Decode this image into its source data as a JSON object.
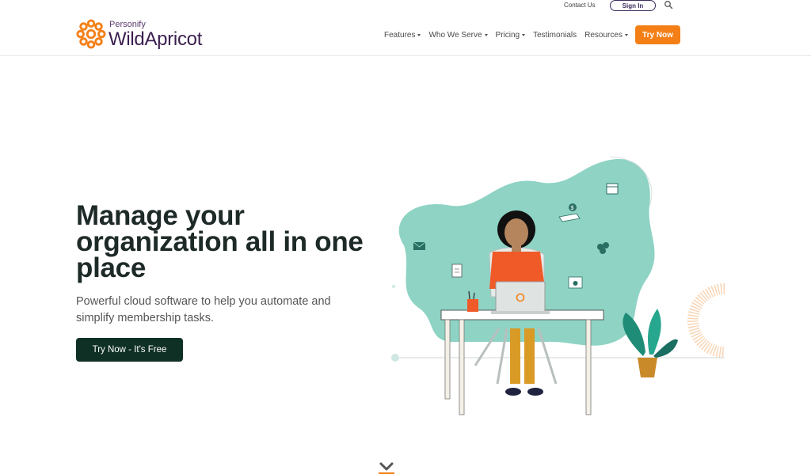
{
  "util": {
    "contact_label": "Contact Us",
    "signin_label": "Sign In",
    "search_icon": "search-icon"
  },
  "logo": {
    "personify": "Personify",
    "name": "WildApricot"
  },
  "nav": {
    "items": [
      {
        "label": "Features",
        "dropdown": true
      },
      {
        "label": "Who We Serve",
        "dropdown": true
      },
      {
        "label": "Pricing",
        "dropdown": true
      },
      {
        "label": "Testimonials",
        "dropdown": false
      },
      {
        "label": "Resources",
        "dropdown": true
      }
    ],
    "cta_label": "Try Now"
  },
  "hero": {
    "title": "Manage your organization all in one place",
    "subtitle": "Powerful cloud software to help you automate and simplify membership tasks.",
    "cta_label": "Try Now - It's Free"
  },
  "colors": {
    "accent_orange": "#f47f16",
    "dark_green": "#0f3025",
    "teal_blob": "#8ed3c4",
    "brand_purple": "#3b1f4f"
  }
}
